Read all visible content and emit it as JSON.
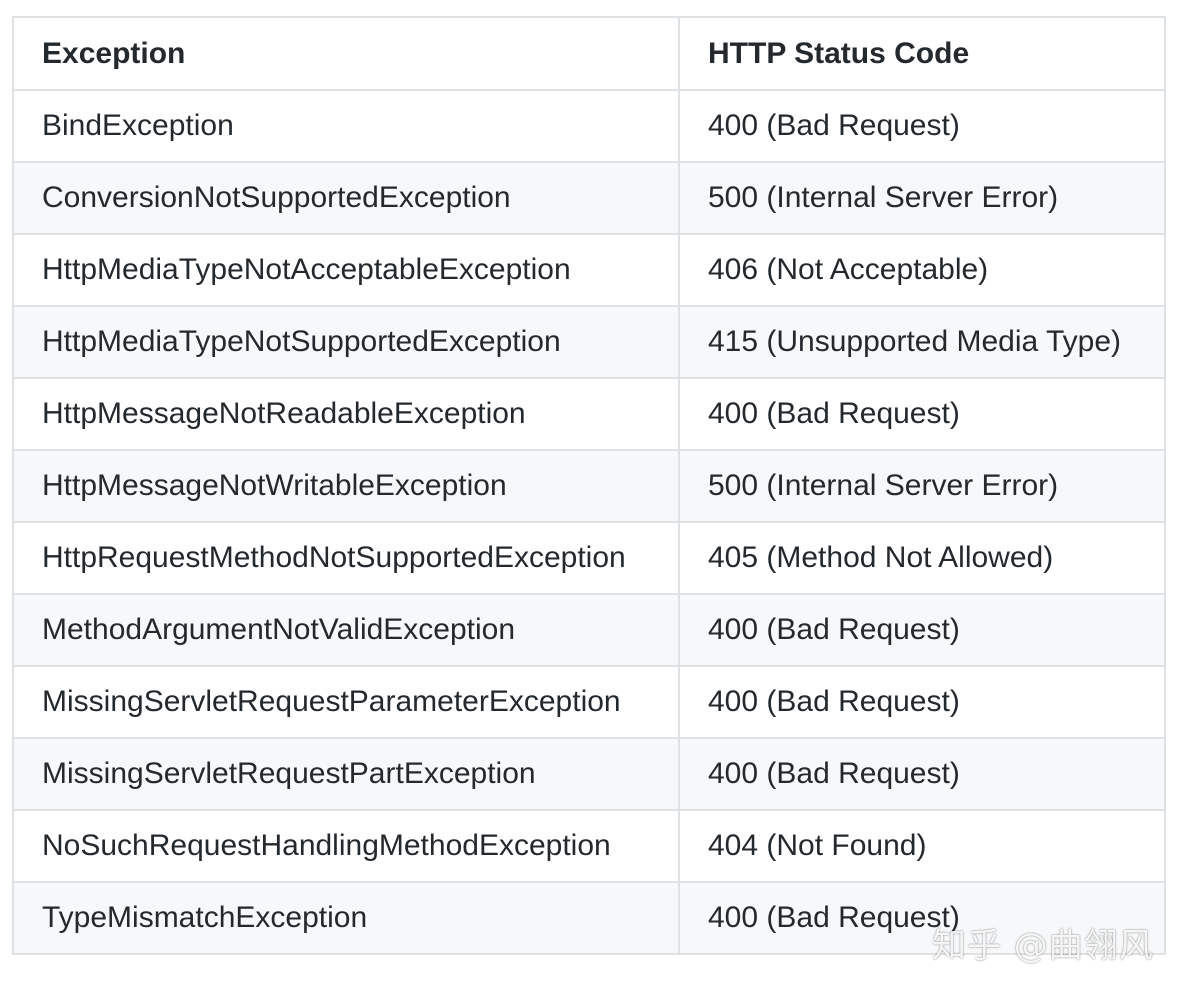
{
  "table": {
    "headers": [
      "Exception",
      "HTTP Status Code"
    ],
    "rows": [
      [
        "BindException",
        "400 (Bad Request)"
      ],
      [
        "ConversionNotSupportedException",
        "500 (Internal Server Error)"
      ],
      [
        "HttpMediaTypeNotAcceptableException",
        "406 (Not Acceptable)"
      ],
      [
        "HttpMediaTypeNotSupportedException",
        "415 (Unsupported Media Type)"
      ],
      [
        "HttpMessageNotReadableException",
        "400 (Bad Request)"
      ],
      [
        "HttpMessageNotWritableException",
        "500 (Internal Server Error)"
      ],
      [
        "HttpRequestMethodNotSupportedException",
        "405 (Method Not Allowed)"
      ],
      [
        "MethodArgumentNotValidException",
        "400 (Bad Request)"
      ],
      [
        "MissingServletRequestParameterException",
        "400 (Bad Request)"
      ],
      [
        "MissingServletRequestPartException",
        "400 (Bad Request)"
      ],
      [
        "NoSuchRequestHandlingMethodException",
        "404 (Not Found)"
      ],
      [
        "TypeMismatchException",
        "400 (Bad Request)"
      ]
    ]
  },
  "watermark": "知乎 @曲翎风",
  "colors": {
    "border": "#dfe2e5",
    "stripe": "#f6f8fa",
    "text": "#24292e"
  }
}
